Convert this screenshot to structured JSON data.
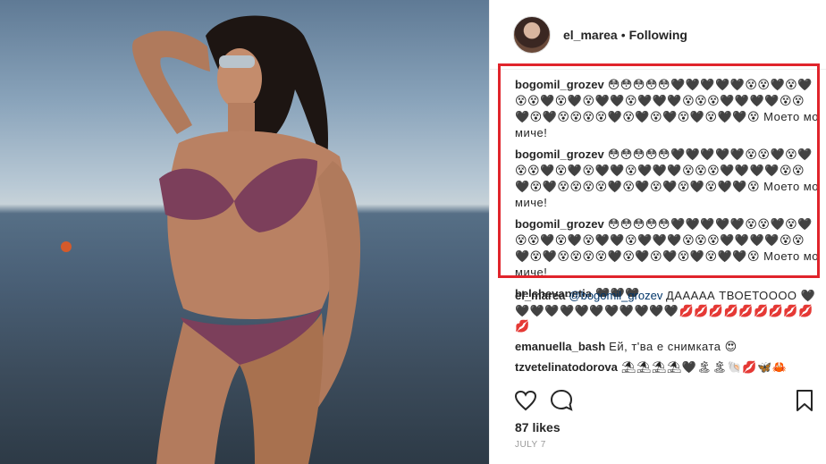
{
  "post": {
    "username": "el_marea",
    "separator": "•",
    "follow_status": "Following"
  },
  "highlighted_comments": [
    {
      "user": "bogomil_grozev",
      "text": "😳😳😳😳😳🖤🖤🖤🖤🖤😵😵🖤😵🖤😵😵🖤😵🖤😵🖤🖤😵🖤🖤🖤😵😵😵🖤🖤🖤🖤😵😵🖤😵🖤😵😵😵😵🖤😵🖤😵🖤😵🖤😵🖤🖤😵 Моето момиче!"
    },
    {
      "user": "bogomil_grozev",
      "text": "😳😳😳😳😳🖤🖤🖤🖤🖤😵😵🖤😵🖤😵😵🖤😵🖤😵🖤🖤😵🖤🖤🖤😵😵😵🖤🖤🖤🖤😵😵🖤😵🖤😵😵😵😵🖤😵🖤😵🖤😵🖤😵🖤🖤😵 Моето момиче!"
    },
    {
      "user": "bogomil_grozev",
      "text": "😳😳😳😳😳🖤🖤🖤🖤🖤😵😵🖤😵🖤😵😵🖤😵🖤😵🖤🖤😵🖤🖤🖤😵😵😵🖤🖤🖤🖤😵😵🖤😵🖤😵😵😵😵🖤😵🖤😵🖤😵🖤😵🖤🖤😵 Моето момиче!"
    },
    {
      "user": "belchevapetia",
      "text": "🖤🖤🖤"
    }
  ],
  "lower_comments": [
    {
      "user": "el_marea",
      "mention": "@bogomil_grozev",
      "text": "ДААААА ТВОЕТОООО 🖤🖤🖤🖤🖤🖤🖤🖤🖤🖤🖤🖤💋💋💋💋💋💋💋💋💋💋"
    },
    {
      "user": "emanuella_bash",
      "mention": "",
      "text": "Ей, т'ва е снимката 😍"
    },
    {
      "user": "tzvetelinatodorova",
      "mention": "",
      "text": "⛱⛱⛱⛱🖤🏝🏝🐚💋🦋🦀"
    }
  ],
  "actions": {
    "like_icon": "heart-icon",
    "comment_icon": "comment-bubble-icon",
    "save_icon": "bookmark-icon"
  },
  "likes": "87 likes",
  "date": "JULY 7",
  "colors": {
    "highlight_border": "#e0242b",
    "mention": "#003569"
  }
}
